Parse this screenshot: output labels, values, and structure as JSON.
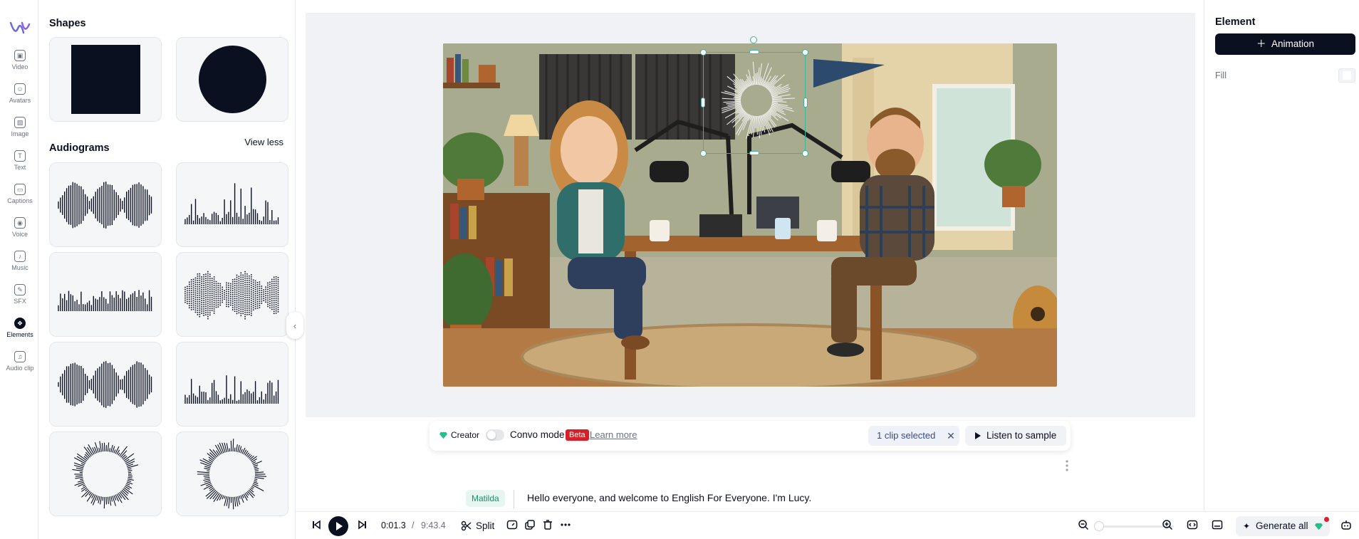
{
  "rail": {
    "items": [
      {
        "label": "Video",
        "icon": "video-icon"
      },
      {
        "label": "Avatars",
        "icon": "avatar-icon"
      },
      {
        "label": "Image",
        "icon": "image-icon"
      },
      {
        "label": "Text",
        "icon": "text-icon"
      },
      {
        "label": "Captions",
        "icon": "captions-icon"
      },
      {
        "label": "Voice",
        "icon": "voice-icon"
      },
      {
        "label": "Music",
        "icon": "music-icon"
      },
      {
        "label": "SFX",
        "icon": "sfx-icon"
      },
      {
        "label": "Elements",
        "icon": "elements-icon",
        "active": true
      },
      {
        "label": "Audio clip",
        "icon": "audio-clip-icon"
      }
    ]
  },
  "assets": {
    "shapes_title": "Shapes",
    "audiograms_title": "Audiograms",
    "view_less": "View less"
  },
  "script_bar": {
    "creator": "Creator",
    "convo_mode": "Convo mode",
    "beta": "Beta",
    "learn_more": "Learn more",
    "clip_selected": "1 clip selected",
    "listen": "Listen to sample"
  },
  "transcript": {
    "speaker": "Matilda",
    "text": "Hello everyone, and welcome to English For Everyone. I'm Lucy."
  },
  "toolbar": {
    "current_time": "0:01.3",
    "separator": "/",
    "total_time": "9:43.4",
    "split": "Split",
    "generate_all": "Generate all"
  },
  "right_panel": {
    "title": "Element",
    "animation_button": "Animation",
    "fill_label": "Fill"
  },
  "colors": {
    "accent_dark": "#0b1020",
    "selection": "#3bb59a",
    "beta_red": "#d61f26",
    "speaker_green": "#1f8f6a"
  }
}
